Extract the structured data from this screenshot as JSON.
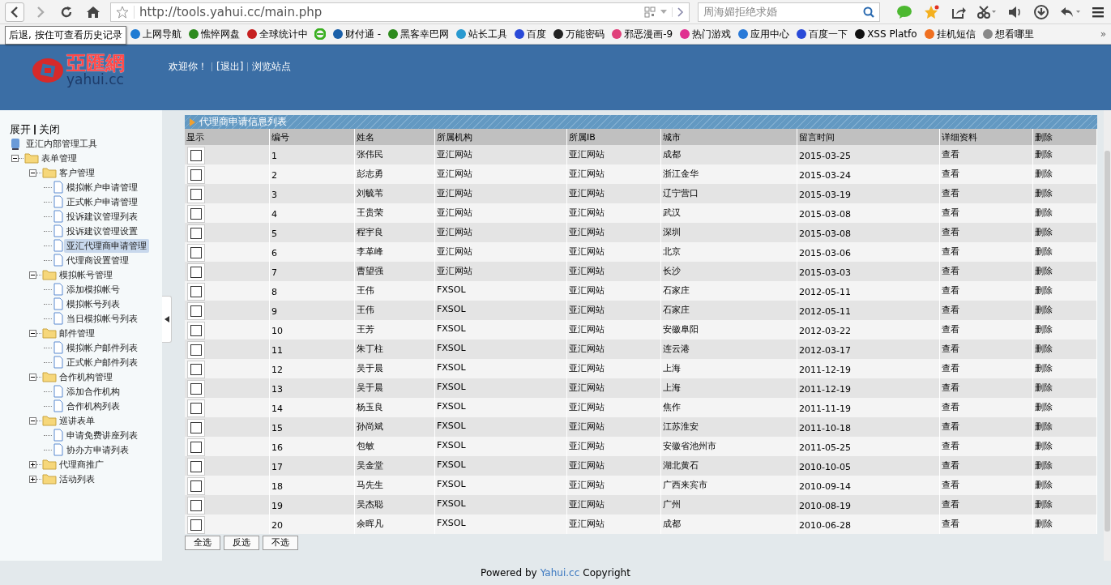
{
  "browser": {
    "url": "http://tools.yahui.cc/main.php",
    "search_placeholder": "周海媚拒绝求婚",
    "tooltip": "后退, 按住可查看历史记录",
    "bookmarks": [
      {
        "kind": "link",
        "label": "上网导航"
      },
      {
        "kind": "link",
        "label": "憔悴网盘"
      },
      {
        "kind": "link",
        "label": "全球统计中"
      },
      {
        "kind": "icon"
      },
      {
        "kind": "link",
        "label": "财付通 -"
      },
      {
        "kind": "link",
        "label": "黑客幸巴网"
      },
      {
        "kind": "link",
        "label": "站长工具"
      },
      {
        "kind": "link",
        "label": "百度"
      },
      {
        "kind": "link",
        "label": "万能密码"
      },
      {
        "kind": "link",
        "label": "邪恶漫画-9"
      },
      {
        "kind": "link",
        "label": "热门游戏"
      },
      {
        "kind": "link",
        "label": "应用中心"
      },
      {
        "kind": "link",
        "label": "百度一下"
      },
      {
        "kind": "link",
        "label": "XSS Platfo"
      },
      {
        "kind": "link",
        "label": "挂机短信"
      },
      {
        "kind": "link",
        "label": "想看哪里"
      }
    ],
    "more": "»"
  },
  "header": {
    "logo_cn": "亞匯網",
    "logo_en": "yahui.cc",
    "links": [
      "欢迎你！",
      "[退出]",
      "浏览站点"
    ]
  },
  "sidebar": {
    "expand": "展开",
    "collapse": "关闭",
    "root": "亚汇内部管理工具",
    "tree": [
      {
        "label": "表单管理",
        "expanded": true,
        "children": [
          {
            "label": "客户管理",
            "expanded": true,
            "children": [
              {
                "label": "模拟帐户申请管理",
                "selected": false
              },
              {
                "label": "正式帐户申请管理",
                "selected": false
              },
              {
                "label": "投诉建议管理列表",
                "selected": false
              },
              {
                "label": "投诉建议管理设置",
                "selected": false
              },
              {
                "label": "亚汇代理商申请管理",
                "selected": true
              },
              {
                "label": "代理商设置管理",
                "selected": false
              }
            ]
          },
          {
            "label": "模拟帐号管理",
            "expanded": true,
            "children": [
              {
                "label": "添加模拟帐号",
                "selected": false
              },
              {
                "label": "模拟帐号列表",
                "selected": false
              },
              {
                "label": "当日模拟帐号列表",
                "selected": false
              }
            ]
          },
          {
            "label": "邮件管理",
            "expanded": true,
            "children": [
              {
                "label": "模拟帐户邮件列表",
                "selected": false
              },
              {
                "label": "正式帐户邮件列表",
                "selected": false
              }
            ]
          },
          {
            "label": "合作机构管理",
            "expanded": true,
            "children": [
              {
                "label": "添加合作机构",
                "selected": false
              },
              {
                "label": "合作机构列表",
                "selected": false
              }
            ]
          },
          {
            "label": "巡讲表单",
            "expanded": true,
            "children": [
              {
                "label": "申请免费讲座列表",
                "selected": false
              },
              {
                "label": "协办方申请列表",
                "selected": false
              }
            ]
          },
          {
            "label": "代理商推广",
            "expanded": false
          },
          {
            "label": "活动列表",
            "expanded": false
          }
        ]
      }
    ]
  },
  "table": {
    "title": "代理商申请信息列表",
    "checkbox_header": "显示",
    "columns": [
      "编号",
      "姓名",
      "所属机构",
      "所属IB",
      "城市",
      "留言时间",
      "详细资料",
      "删除"
    ],
    "rows": [
      {
        "checked": false,
        "cells": [
          "1",
          "张伟民",
          "亚汇网站",
          "亚汇网站",
          "成都",
          "2015-03-25",
          "查看",
          "删除"
        ]
      },
      {
        "checked": false,
        "cells": [
          "2",
          "彭志勇",
          "亚汇网站",
          "亚汇网站",
          "浙江金华",
          "2015-03-24",
          "查看",
          "删除"
        ]
      },
      {
        "checked": false,
        "cells": [
          "3",
          "刘毓苇",
          "亚汇网站",
          "亚汇网站",
          "辽宁营口",
          "2015-03-19",
          "查看",
          "删除"
        ]
      },
      {
        "checked": false,
        "cells": [
          "4",
          "王贵荣",
          "亚汇网站",
          "亚汇网站",
          "武汉",
          "2015-03-08",
          "查看",
          "删除"
        ]
      },
      {
        "checked": false,
        "cells": [
          "5",
          "程宇良",
          "亚汇网站",
          "亚汇网站",
          "深圳",
          "2015-03-08",
          "查看",
          "删除"
        ]
      },
      {
        "checked": false,
        "cells": [
          "6",
          "李革峰",
          "亚汇网站",
          "亚汇网站",
          "北京",
          "2015-03-06",
          "查看",
          "删除"
        ]
      },
      {
        "checked": false,
        "cells": [
          "7",
          "曹望强",
          "亚汇网站",
          "亚汇网站",
          "长沙",
          "2015-03-03",
          "查看",
          "删除"
        ]
      },
      {
        "checked": false,
        "cells": [
          "8",
          "王伟",
          "FXSOL",
          "亚汇网站",
          "石家庄",
          "2012-05-11",
          "查看",
          "删除"
        ]
      },
      {
        "checked": false,
        "cells": [
          "9",
          "王伟",
          "FXSOL",
          "亚汇网站",
          "石家庄",
          "2012-05-11",
          "查看",
          "删除"
        ]
      },
      {
        "checked": false,
        "cells": [
          "10",
          "王芳",
          "FXSOL",
          "亚汇网站",
          "安徽阜阳",
          "2012-03-22",
          "查看",
          "删除"
        ]
      },
      {
        "checked": false,
        "cells": [
          "11",
          "朱丁柱",
          "FXSOL",
          "亚汇网站",
          "连云港",
          "2012-03-17",
          "查看",
          "删除"
        ]
      },
      {
        "checked": false,
        "cells": [
          "12",
          "吴于晨",
          "FXSOL",
          "亚汇网站",
          "上海",
          "2011-12-19",
          "查看",
          "删除"
        ]
      },
      {
        "checked": false,
        "cells": [
          "13",
          "吴于晨",
          "FXSOL",
          "亚汇网站",
          "上海",
          "2011-12-19",
          "查看",
          "删除"
        ]
      },
      {
        "checked": false,
        "cells": [
          "14",
          "杨玉良",
          "FXSOL",
          "亚汇网站",
          "焦作",
          "2011-11-19",
          "查看",
          "删除"
        ]
      },
      {
        "checked": false,
        "cells": [
          "15",
          "孙尚斌",
          "FXSOL",
          "亚汇网站",
          "江苏淮安",
          "2011-10-18",
          "查看",
          "删除"
        ]
      },
      {
        "checked": false,
        "cells": [
          "16",
          "包敏",
          "FXSOL",
          "亚汇网站",
          "安徽省池州市",
          "2011-05-25",
          "查看",
          "删除"
        ]
      },
      {
        "checked": false,
        "cells": [
          "17",
          "吴金堂",
          "FXSOL",
          "亚汇网站",
          "湖北黄石",
          "2010-10-05",
          "查看",
          "删除"
        ]
      },
      {
        "checked": false,
        "cells": [
          "18",
          "马先生",
          "FXSOL",
          "亚汇网站",
          "广西来宾市",
          "2010-09-14",
          "查看",
          "删除"
        ]
      },
      {
        "checked": false,
        "cells": [
          "19",
          "吴杰聪",
          "FXSOL",
          "亚汇网站",
          "广州",
          "2010-08-19",
          "查看",
          "删除"
        ]
      },
      {
        "checked": false,
        "cells": [
          "20",
          "余晖凡",
          "FXSOL",
          "亚汇网站",
          "成都",
          "2010-06-28",
          "查看",
          "删除"
        ]
      }
    ],
    "pager_buttons": [
      "全选",
      "反选",
      "不选"
    ]
  },
  "footer": {
    "prefix": "Powered by",
    "link": "Yahui.cc",
    "suffix": "Copyright"
  }
}
